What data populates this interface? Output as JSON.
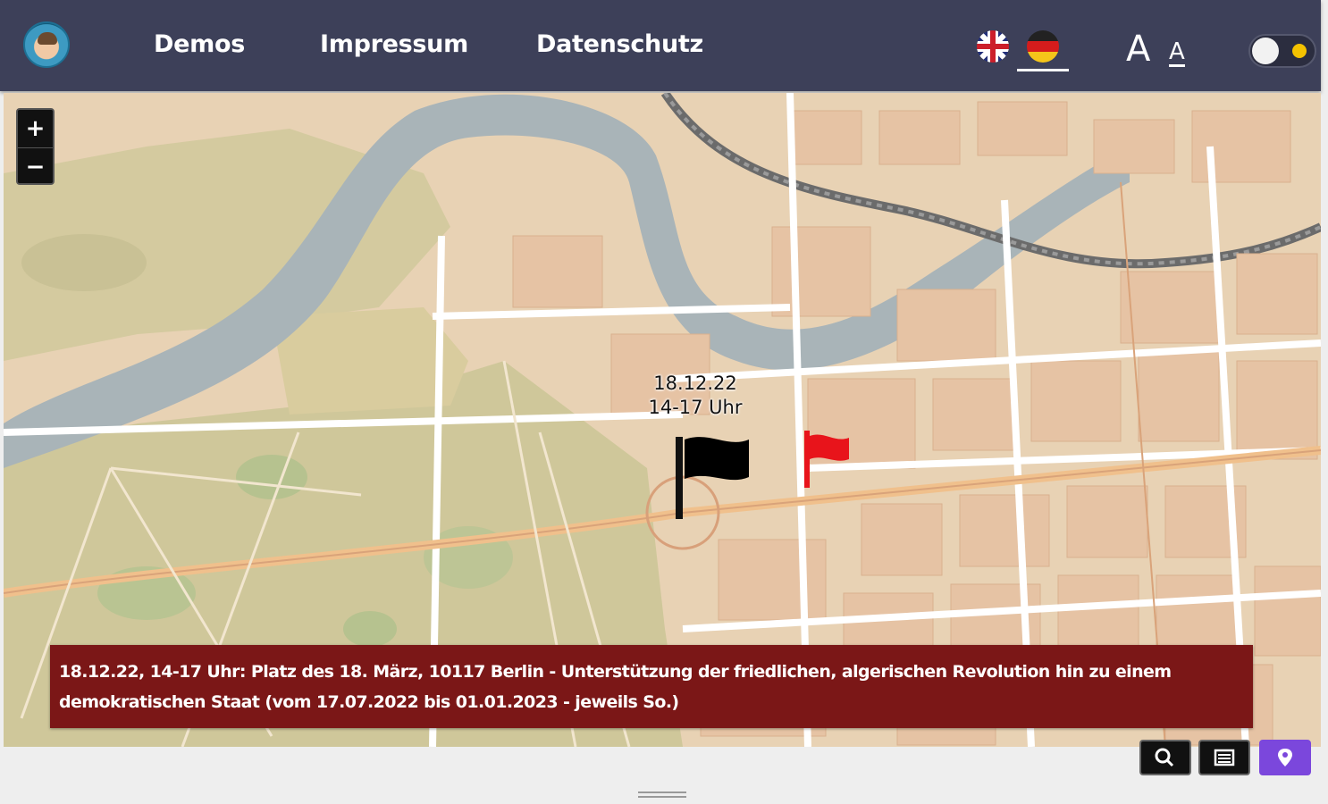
{
  "header": {
    "logo": "avatar-logo",
    "nav": [
      {
        "label": "Demos"
      },
      {
        "label": "Impressum"
      },
      {
        "label": "Datenschutz"
      }
    ],
    "languages": [
      {
        "icon": "uk-flag-icon",
        "code": "en"
      },
      {
        "icon": "german-flag-icon",
        "code": "de",
        "selected": true
      }
    ],
    "font_size_large": "A",
    "font_size_small": "A",
    "dark_mode": false
  },
  "map": {
    "zoom_in": "+",
    "zoom_out": "−",
    "marker_label": {
      "date": "18.12.22",
      "time": "14-17 Uhr"
    },
    "markers": [
      {
        "icon": "black-flag-icon",
        "color": "#000000"
      },
      {
        "icon": "red-flag-icon",
        "color": "#e8141b"
      }
    ],
    "info": "18.12.22, 14-17 Uhr: Platz des 18. März, 10117 Berlin - Unterstützung der friedlichen, algerischen Revolution hin zu einem demokratischen Staat (vom 17.07.2022 bis 01.01.2023 - jeweils So.)"
  },
  "controls": [
    {
      "icon": "search-icon"
    },
    {
      "icon": "list-icon"
    },
    {
      "icon": "location-pin-icon",
      "active": true
    }
  ],
  "colors": {
    "header": "#3d4059",
    "banner": "#7b1717",
    "accent": "#7b47dc"
  }
}
